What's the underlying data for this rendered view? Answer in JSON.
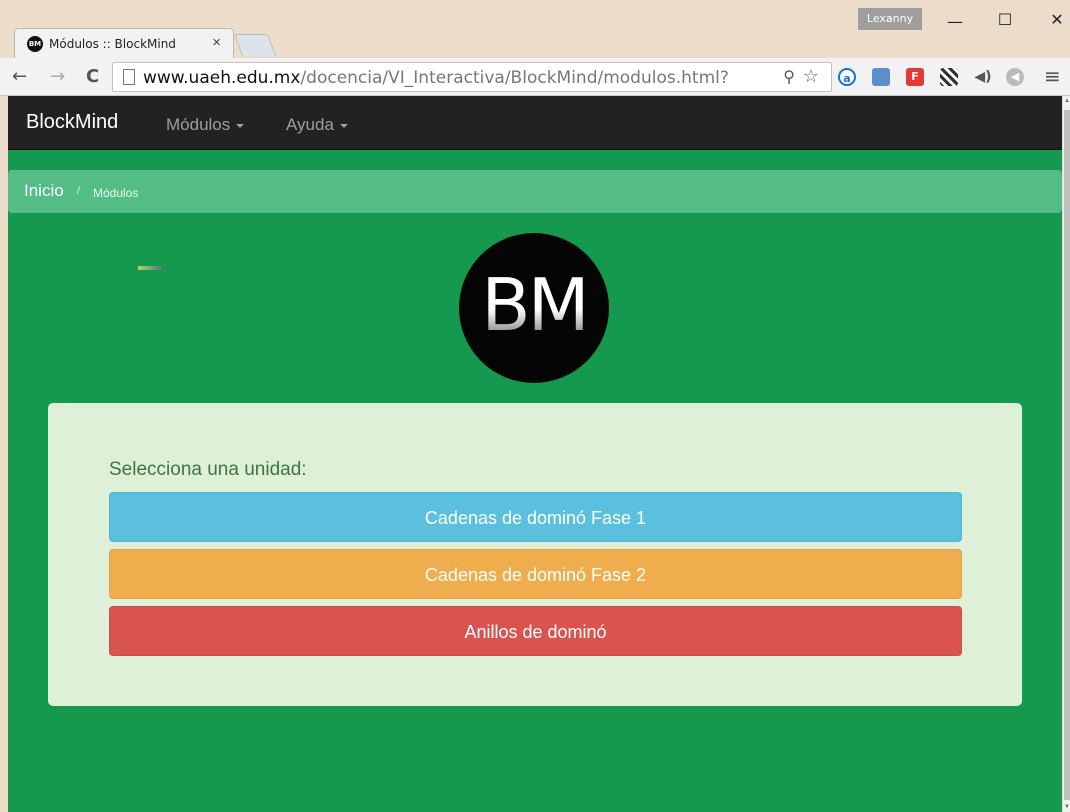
{
  "browser": {
    "tab_title": "Módulos :: BlockMind",
    "tab_favicon_text": "BM",
    "profile_name": "Lexanny",
    "url_host": "www.uaeh.edu.mx",
    "url_path": "/docencia/VI_Interactiva/BlockMind/modulos.html?"
  },
  "navbar": {
    "brand": "BlockMind",
    "menu": [
      {
        "label": "Módulos"
      },
      {
        "label": "Ayuda"
      }
    ],
    "background": "#222222"
  },
  "breadcrumb": {
    "home": "Inicio",
    "separator": "/",
    "current": "Módulos"
  },
  "logo": {
    "text": "BM"
  },
  "panel": {
    "prompt": "Selecciona una unidad:",
    "buttons": [
      {
        "label": "Cadenas de dominó Fase 1",
        "color": "#5bc0de"
      },
      {
        "label": "Cadenas de dominó Fase 2",
        "color": "#f0ad4e"
      },
      {
        "label": "Anillos de dominó",
        "color": "#d9534f"
      }
    ]
  },
  "colors": {
    "page_background": "#14994f",
    "breadcrumb_background": "#53bd85",
    "panel_background": "#dff0d8"
  }
}
